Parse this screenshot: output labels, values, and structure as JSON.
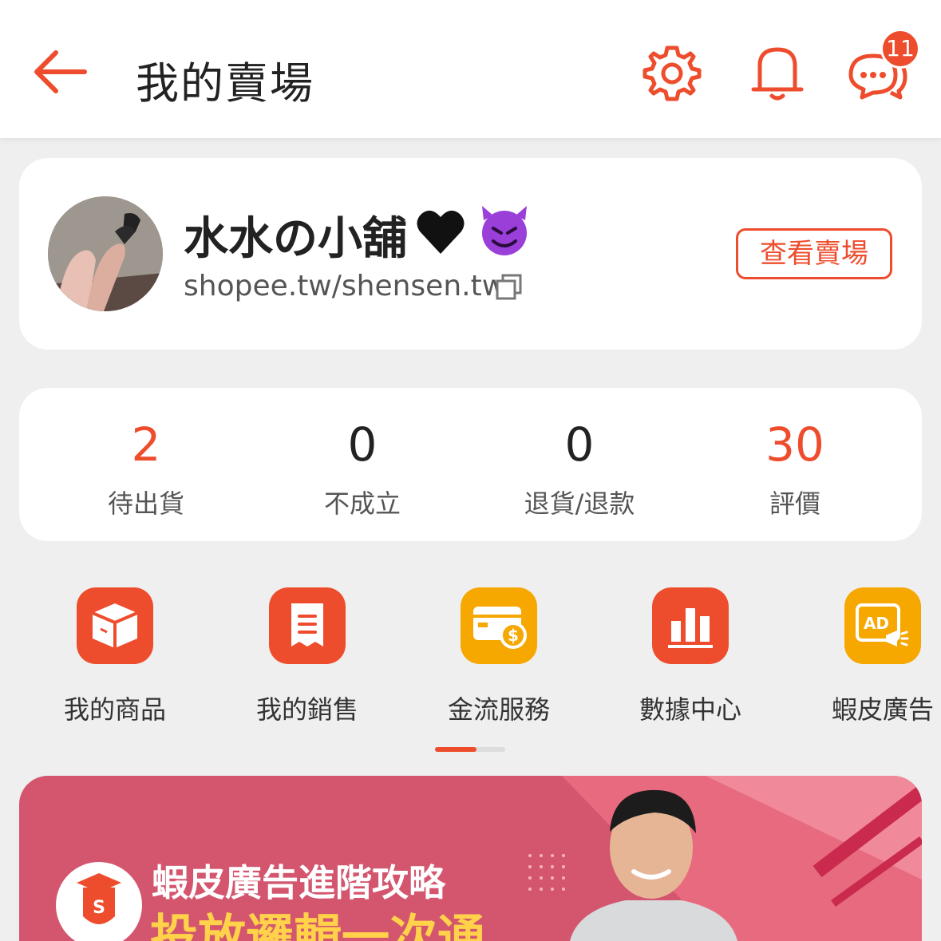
{
  "header": {
    "title": "我的賣場",
    "chat_badge": "11"
  },
  "shop": {
    "name": "水水の小舖",
    "url": "shopee.tw/shensen.tw",
    "view_button": "查看賣場"
  },
  "stats": [
    {
      "value": "2",
      "label": "待出貨"
    },
    {
      "value": "0",
      "label": "不成立"
    },
    {
      "value": "0",
      "label": "退貨/退款"
    },
    {
      "value": "30",
      "label": "評價"
    }
  ],
  "shortcuts": [
    {
      "label": "我的商品",
      "icon": "box-icon",
      "color": "#ee4d2d"
    },
    {
      "label": "我的銷售",
      "icon": "receipt-icon",
      "color": "#ee4d2d"
    },
    {
      "label": "金流服務",
      "icon": "wallet-icon",
      "color": "#f6a700"
    },
    {
      "label": "數據中心",
      "icon": "bar-chart-icon",
      "color": "#ee4d2d"
    },
    {
      "label": "蝦皮廣告",
      "icon": "ad-megaphone-icon",
      "color": "#f6a700"
    }
  ],
  "banner": {
    "title": "蝦皮廣告進階攻略",
    "subtitle": "投放邏輯一次通"
  },
  "colors": {
    "accent": "#ee4d2d",
    "gold": "#f6a700",
    "banner_bg": "#d3566e"
  }
}
